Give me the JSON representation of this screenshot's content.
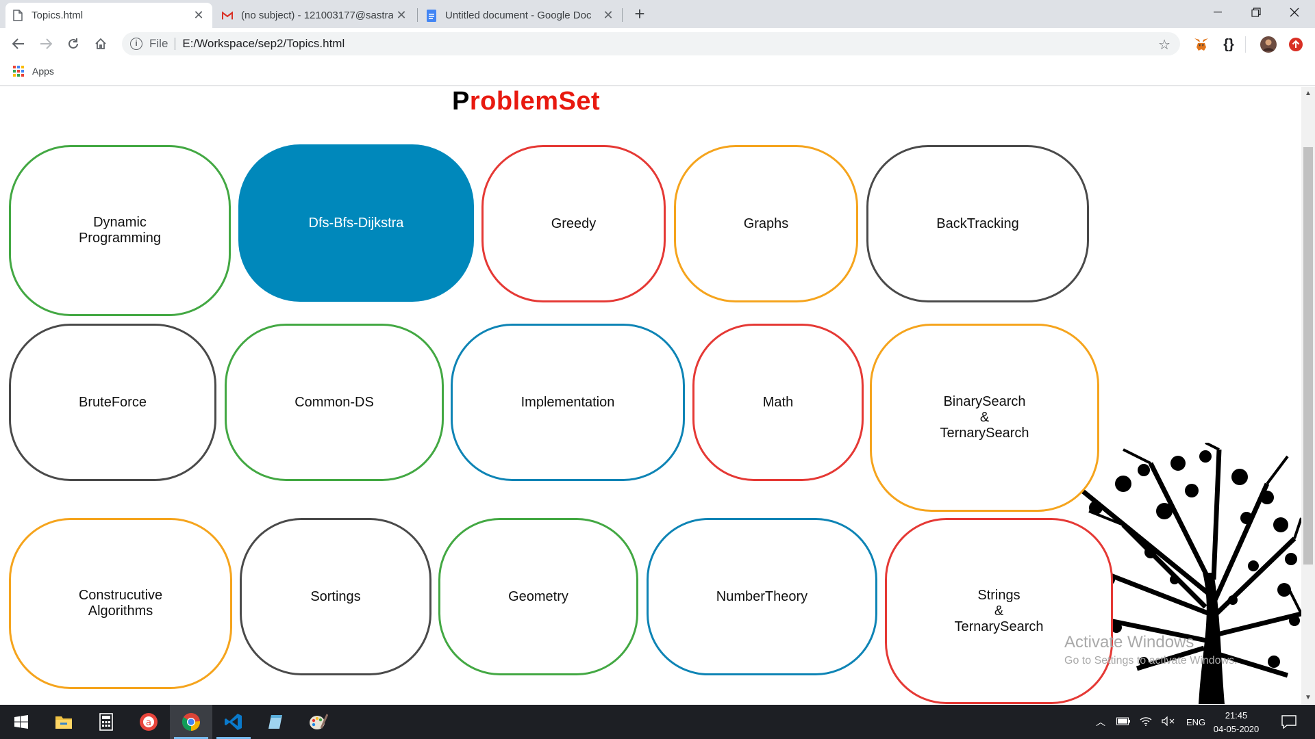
{
  "browser": {
    "tabs": [
      {
        "title": "Topics.html",
        "icon": "document-icon",
        "active": true
      },
      {
        "title": "(no subject) - 121003177@sastra",
        "icon": "gmail-icon",
        "active": false
      },
      {
        "title": "Untitled document - Google Doc",
        "icon": "google-docs-icon",
        "active": false
      }
    ],
    "new_tab": "+",
    "address": {
      "scheme": "File",
      "url": "E:/Workspace/sep2/Topics.html"
    },
    "bookmarks": {
      "apps_label": "Apps"
    }
  },
  "page": {
    "title_first": "P",
    "title_rest": "roblemSet",
    "topics": [
      {
        "label": "Dynamic\nProgramming",
        "color": "#43a843"
      },
      {
        "label": "Dfs-Bfs-Dijkstra",
        "color": "#0088bb",
        "filled": true
      },
      {
        "label": "Greedy",
        "color": "#e53935"
      },
      {
        "label": "Graphs",
        "color": "#f5a41d"
      },
      {
        "label": "BackTracking",
        "color": "#4a4a4a"
      },
      {
        "label": "BruteForce",
        "color": "#4a4a4a"
      },
      {
        "label": "Common-DS",
        "color": "#43a843"
      },
      {
        "label": "Implementation",
        "color": "#0e84b5"
      },
      {
        "label": "Math",
        "color": "#e53935"
      },
      {
        "label": "BinarySearch\n&\nTernarySearch",
        "color": "#f5a41d"
      },
      {
        "label": "Construcutive\nAlgorithms",
        "color": "#f5a41d"
      },
      {
        "label": "Sortings",
        "color": "#4a4a4a"
      },
      {
        "label": "Geometry",
        "color": "#43a843"
      },
      {
        "label": "NumberTheory",
        "color": "#0e84b5"
      },
      {
        "label": "Strings\n&\nTernarySearch",
        "color": "#e53935"
      }
    ],
    "watermark": {
      "line1": "Activate Windows",
      "line2": "Go to Settings to activate Windows."
    }
  },
  "taskbar": {
    "apps": [
      "windows-start-icon",
      "file-explorer-icon",
      "calculator-icon",
      "app-icon",
      "chrome-icon",
      "vscode-icon",
      "notes-icon",
      "paint-icon"
    ],
    "language": "ENG",
    "time": "21:45",
    "date": "04-05-2020"
  }
}
